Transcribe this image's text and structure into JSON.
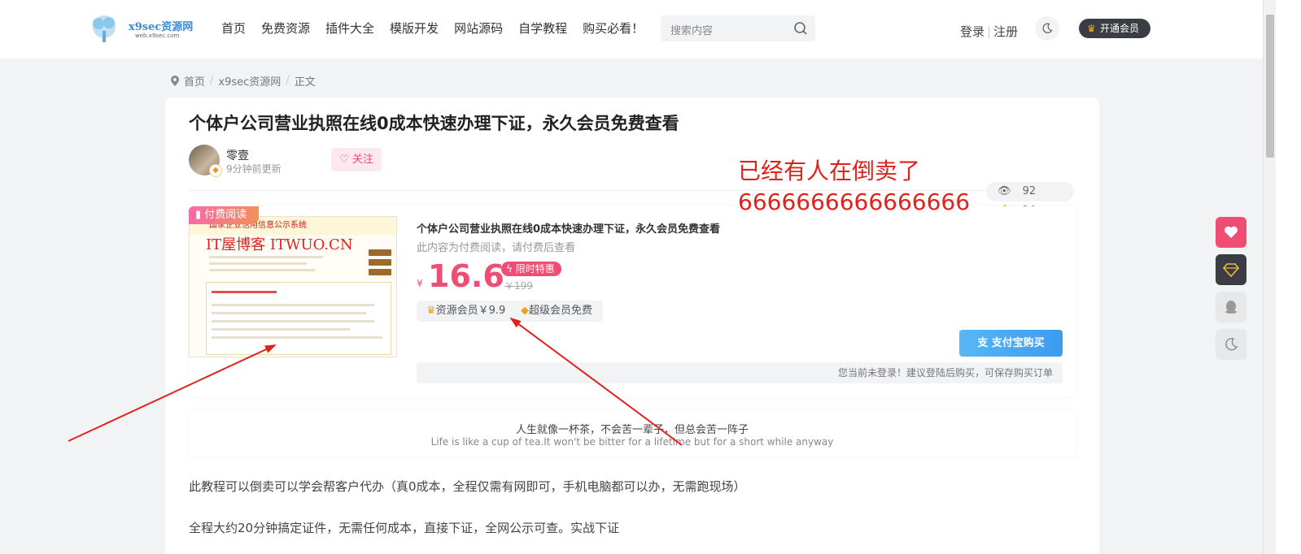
{
  "header": {
    "logo_text": "x9sec资源网",
    "logo_sub": "web.x9sec.com",
    "nav": [
      "首页",
      "免费资源",
      "插件大全",
      "模版开发",
      "网站源码",
      "自学教程",
      "购买必看！"
    ],
    "search_placeholder": "搜索内容",
    "login": "登录",
    "register": "注册",
    "vip_button": "开通会员"
  },
  "breadcrumb": [
    "首页",
    "x9sec资源网",
    "正文"
  ],
  "article": {
    "title": "个体户公司营业执照在线0成本快速办理下证，永久会员免费查看",
    "author": "零壹",
    "updated": "9分钟前更新",
    "follow": "关注",
    "views": "92",
    "likes": "14"
  },
  "paybox": {
    "tag": "付费阅读",
    "thumb_header": "国家企业信用信息公示系统",
    "thumb_watermark": "IT屋博客 ITWUO.CN",
    "title": "个体户公司营业执照在线0成本快速办理下证，永久会员免费查看",
    "desc": "此内容为付费阅读，请付费后查看",
    "currency": "¥",
    "price": "16.6",
    "promo": "限时特惠",
    "original_price": "￥199",
    "vip_price": "资源会员￥9.9",
    "super_vip": "超级会员免费",
    "buy_button": "支付宝购买",
    "login_tip": "您当前未登录！建议登陆后购买，可保存购买订单"
  },
  "quote": {
    "zh": "人生就像一杯茶，不会苦一辈子，但总会苦一阵子",
    "en": "Life is like a cup of tea.It won't be bitter for a lifetime but for a short while anyway"
  },
  "body": {
    "para1": "此教程可以倒卖可以学会帮客户代办（真0成本，全程仅需有网即可，手机电脑都可以办，无需跑现场）",
    "para2": "全程大约20分钟搞定证件，无需任何成本，直接下证，全网公示可查。实战下证"
  },
  "annotation": {
    "line1": "已经有人在倒卖了",
    "line2": "6666666666666666"
  },
  "colors": {
    "accent": "#f04d74",
    "annotation": "#e0221c",
    "buy": "#3a9cf0"
  }
}
